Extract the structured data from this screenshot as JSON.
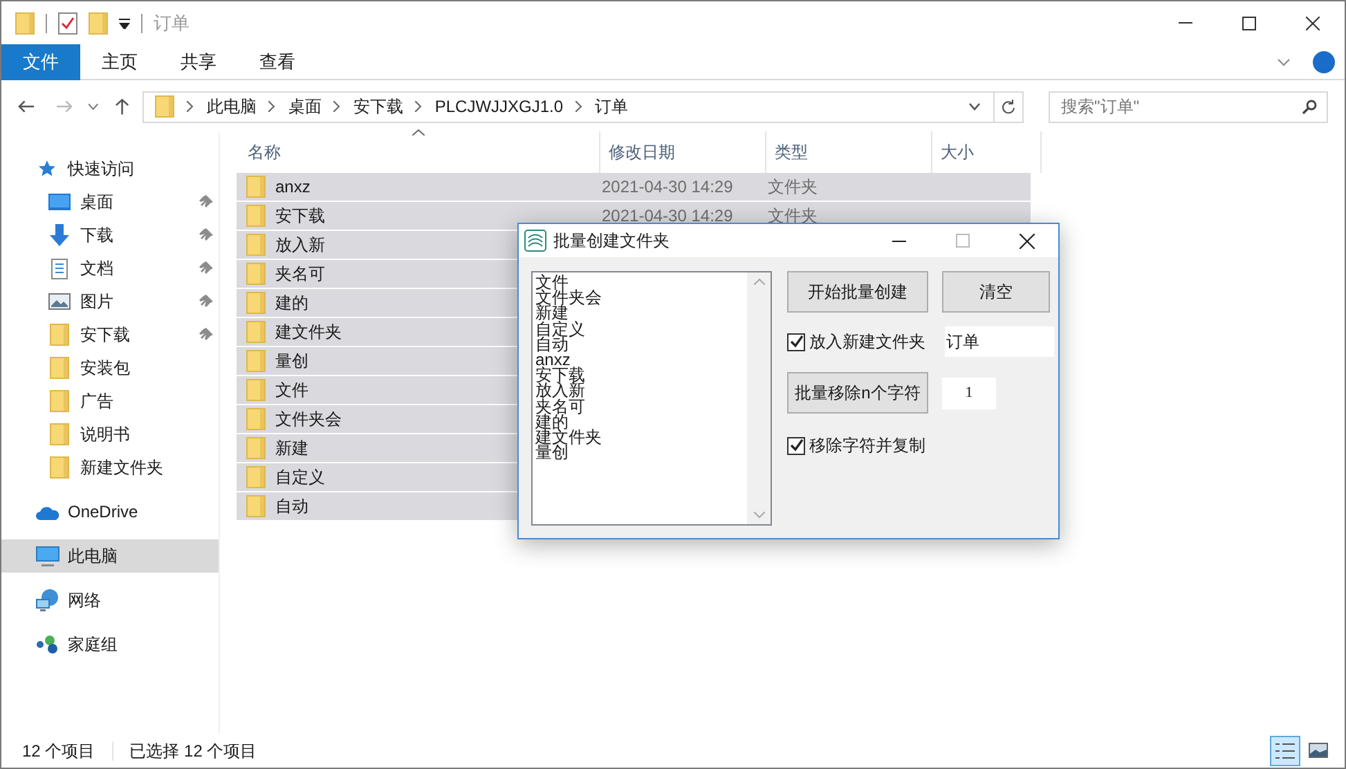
{
  "window": {
    "title": "订单"
  },
  "ribbon_tabs": [
    {
      "label": "文件",
      "selected": true
    },
    {
      "label": "主页",
      "selected": false
    },
    {
      "label": "共享",
      "selected": false
    },
    {
      "label": "查看",
      "selected": false
    }
  ],
  "breadcrumb": [
    "此电脑",
    "桌面",
    "安下载",
    "PLCJWJJXGJ1.0",
    "订单"
  ],
  "search": {
    "placeholder": "搜索\"订单\""
  },
  "columns": [
    "名称",
    "修改日期",
    "类型",
    "大小"
  ],
  "sidebar": [
    {
      "label": "快速访问",
      "kind": "star",
      "selected": false,
      "children": [
        {
          "label": "桌面",
          "kind": "desktop",
          "pinned": true,
          "selected": false
        },
        {
          "label": "下载",
          "kind": "download",
          "pinned": true,
          "selected": false
        },
        {
          "label": "文档",
          "kind": "document",
          "pinned": true,
          "selected": false
        },
        {
          "label": "图片",
          "kind": "image",
          "pinned": true,
          "selected": false
        },
        {
          "label": "安下载",
          "kind": "folder",
          "pinned": true,
          "selected": false
        },
        {
          "label": "安装包",
          "kind": "folder",
          "pinned": false,
          "selected": false
        },
        {
          "label": "广告",
          "kind": "folder",
          "pinned": false,
          "selected": false
        },
        {
          "label": "说明书",
          "kind": "folder",
          "pinned": false,
          "selected": false
        },
        {
          "label": "新建文件夹",
          "kind": "folder",
          "pinned": false,
          "selected": false
        }
      ]
    },
    {
      "label": "OneDrive",
      "kind": "cloud",
      "selected": false
    },
    {
      "label": "此电脑",
      "kind": "computer",
      "selected": true
    },
    {
      "label": "网络",
      "kind": "network",
      "selected": false
    },
    {
      "label": "家庭组",
      "kind": "homegroup",
      "selected": false
    }
  ],
  "files": [
    {
      "name": "anxz",
      "date": "2021-04-30 14:29",
      "type": "文件夹",
      "selected": true
    },
    {
      "name": "安下载",
      "date": "2021-04-30 14:29",
      "type": "文件夹",
      "selected": true
    },
    {
      "name": "放入新",
      "selected": true
    },
    {
      "name": "夹名可",
      "selected": true
    },
    {
      "name": "建的",
      "selected": true
    },
    {
      "name": "建文件夹",
      "selected": true
    },
    {
      "name": "量创",
      "selected": true
    },
    {
      "name": "文件",
      "selected": true
    },
    {
      "name": "文件夹会",
      "selected": true
    },
    {
      "name": "新建",
      "selected": true
    },
    {
      "name": "自定义",
      "selected": true
    },
    {
      "name": "自动",
      "selected": true
    }
  ],
  "dialog": {
    "title": "批量创建文件夹",
    "list": [
      "文件",
      "文件夹会",
      "新建",
      "自定义",
      "自动",
      "anxz",
      "安下载",
      "放入新",
      "夹名可",
      "建的",
      "建文件夹",
      "量创"
    ],
    "create_button": "开始批量创建",
    "clear_button": "清空",
    "new_folder": {
      "label": "放入新建文件夹",
      "checked": true,
      "value": "订单"
    },
    "remove_button": "批量移除n个字符",
    "remove_count": "1",
    "copy_option": {
      "label": "移除字符并复制",
      "checked": true
    }
  },
  "status_bar": [
    "12 个项目",
    "已选择 12 个项目"
  ],
  "view_buttons": [
    {
      "kind": "details",
      "selected": true
    },
    {
      "kind": "tiles",
      "selected": false
    }
  ]
}
